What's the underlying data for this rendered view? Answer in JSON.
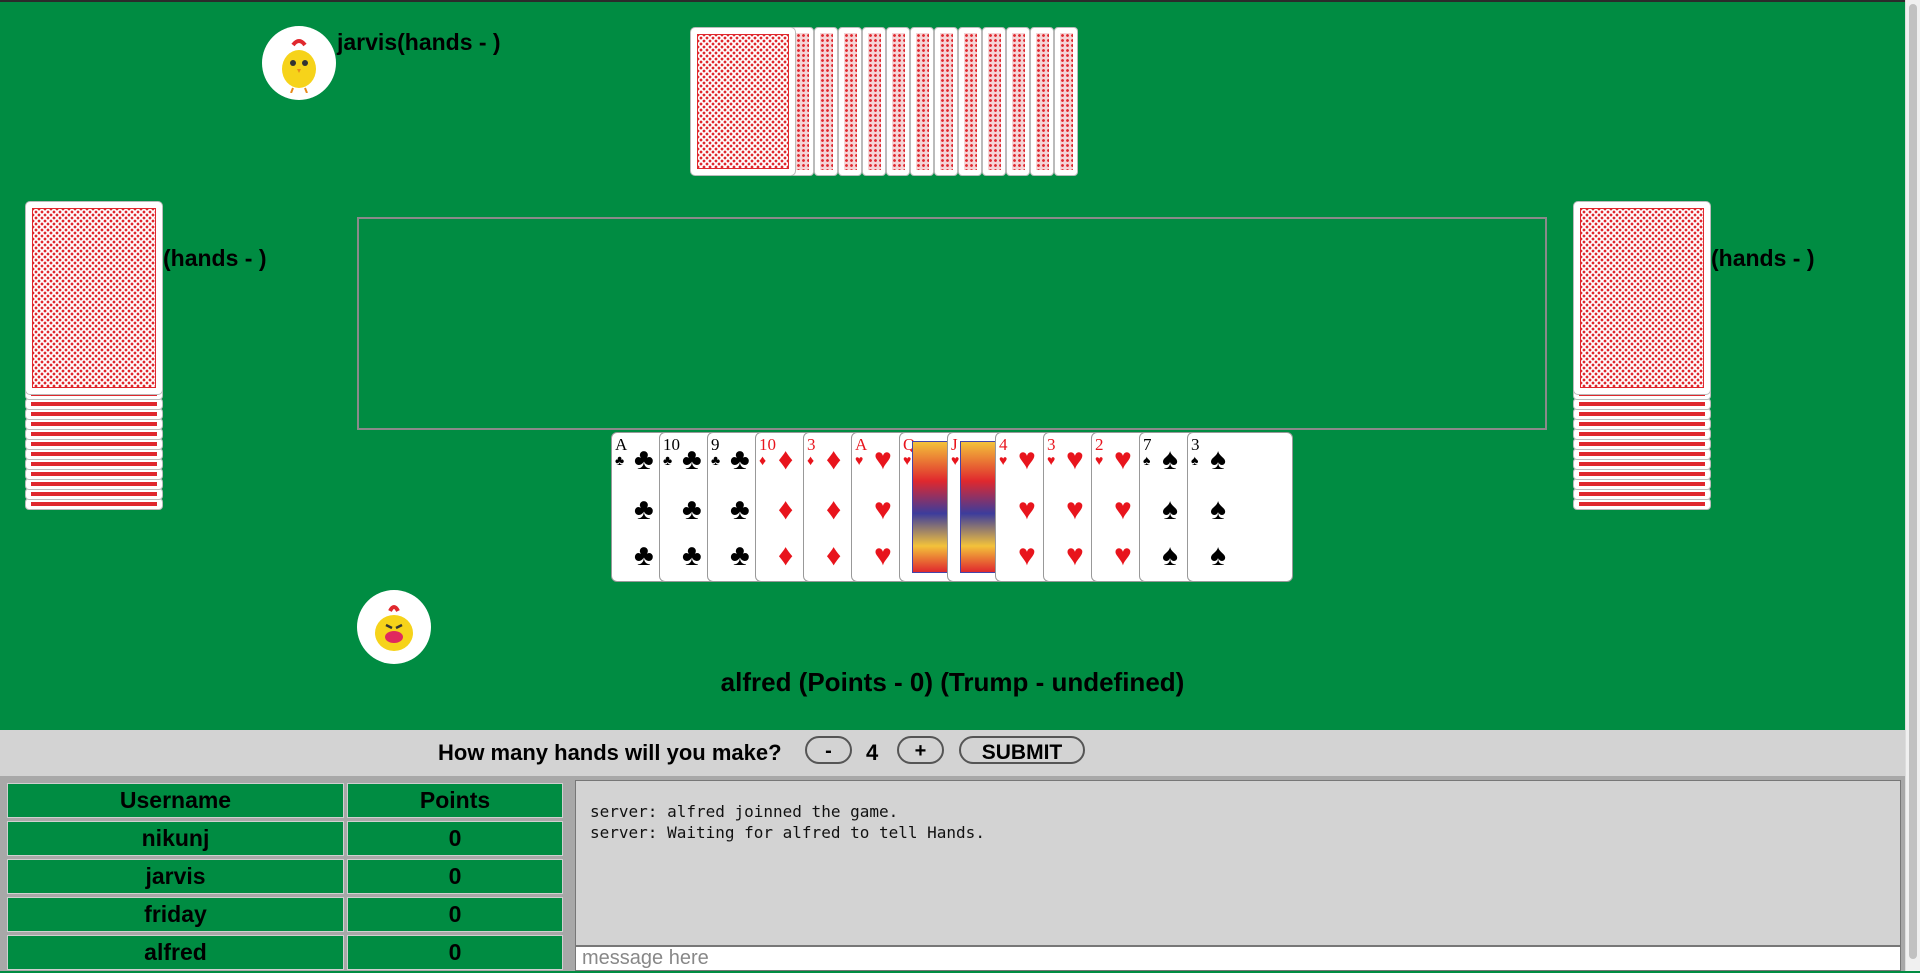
{
  "players": {
    "top": {
      "label": "jarvis(hands - )"
    },
    "left": {
      "label": "(hands - )"
    },
    "right": {
      "label": "(hands - )"
    },
    "me": {
      "status": "alfred (Points - 0) (Trump - undefined)"
    }
  },
  "hand": [
    {
      "rank": "A",
      "suit": "♣",
      "color": "black"
    },
    {
      "rank": "10",
      "suit": "♣",
      "color": "black"
    },
    {
      "rank": "9",
      "suit": "♣",
      "color": "black"
    },
    {
      "rank": "10",
      "suit": "♦",
      "color": "red"
    },
    {
      "rank": "3",
      "suit": "♦",
      "color": "red"
    },
    {
      "rank": "A",
      "suit": "♥",
      "color": "red"
    },
    {
      "rank": "Q",
      "suit": "♥",
      "color": "red"
    },
    {
      "rank": "J",
      "suit": "♥",
      "color": "red"
    },
    {
      "rank": "4",
      "suit": "♥",
      "color": "red"
    },
    {
      "rank": "3",
      "suit": "♥",
      "color": "red"
    },
    {
      "rank": "2",
      "suit": "♥",
      "color": "red"
    },
    {
      "rank": "7",
      "suit": "♠",
      "color": "black"
    },
    {
      "rank": "3",
      "suit": "♠",
      "color": "black"
    }
  ],
  "bid": {
    "question": "How many hands will you make?",
    "minus_label": "-",
    "value": "4",
    "plus_label": "+",
    "submit_label": "SUBMIT"
  },
  "scoreboard": {
    "headers": [
      "Username",
      "Points"
    ],
    "rows": [
      {
        "username": "nikunj",
        "points": "0"
      },
      {
        "username": "jarvis",
        "points": "0"
      },
      {
        "username": "friday",
        "points": "0"
      },
      {
        "username": "alfred",
        "points": "0"
      }
    ]
  },
  "chat": {
    "messages": [
      "server: alfred joinned the game.",
      "server: Waiting for alfred to tell Hands."
    ],
    "placeholder": "message here"
  }
}
